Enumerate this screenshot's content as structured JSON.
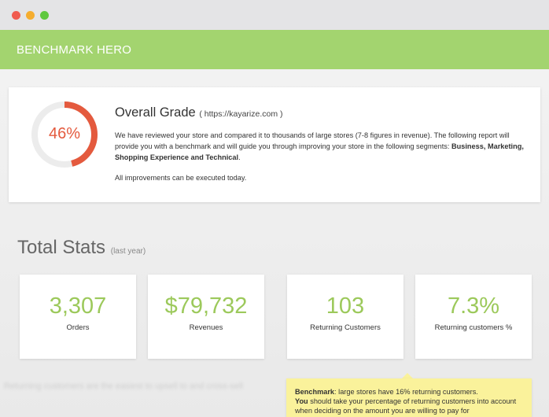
{
  "window": {
    "controls": [
      "close",
      "minimize",
      "maximize"
    ],
    "colors": {
      "close": "#f05b4f",
      "minimize": "#f5ad2f",
      "maximize": "#5fc83f"
    }
  },
  "header": {
    "title": "BENCHMARK HERO",
    "background": "#a3d46f"
  },
  "grade": {
    "percent_text": "46%",
    "percent_value": 0.46,
    "gauge_color": "#e45a3e",
    "title": "Overall Grade",
    "url": "( https://kayarize.com )",
    "description": "We have reviewed your store and compared it to thousands of large stores (7-8 figures in revenue). The following report will provide you with a benchmark and will guide you through improving your store in the following segments:",
    "segments": "Business, Marketing, Shopping Experience and Technical",
    "note": "All improvements can be executed today."
  },
  "stats": {
    "heading": "Total Stats",
    "subheading": "(last year)",
    "accent": "#9cc95b",
    "items": [
      {
        "value": "3,307",
        "label": "Orders"
      },
      {
        "value": "$79,732",
        "label": "Revenues"
      },
      {
        "value": "103",
        "label": "Returning Customers"
      },
      {
        "value": "7.3%",
        "label": "Returning customers %"
      }
    ]
  },
  "tooltip": {
    "benchmark_label": "Benchmark",
    "benchmark_text": ": large stores have 16% returning customers.",
    "you_label": "You",
    "you_text": " should take your percentage of returning customers into account when deciding on the amount you are willing to pay for",
    "background": "#faf29b"
  },
  "background_hint": "Returning customers are the easiest to upsell to and cross-sell"
}
